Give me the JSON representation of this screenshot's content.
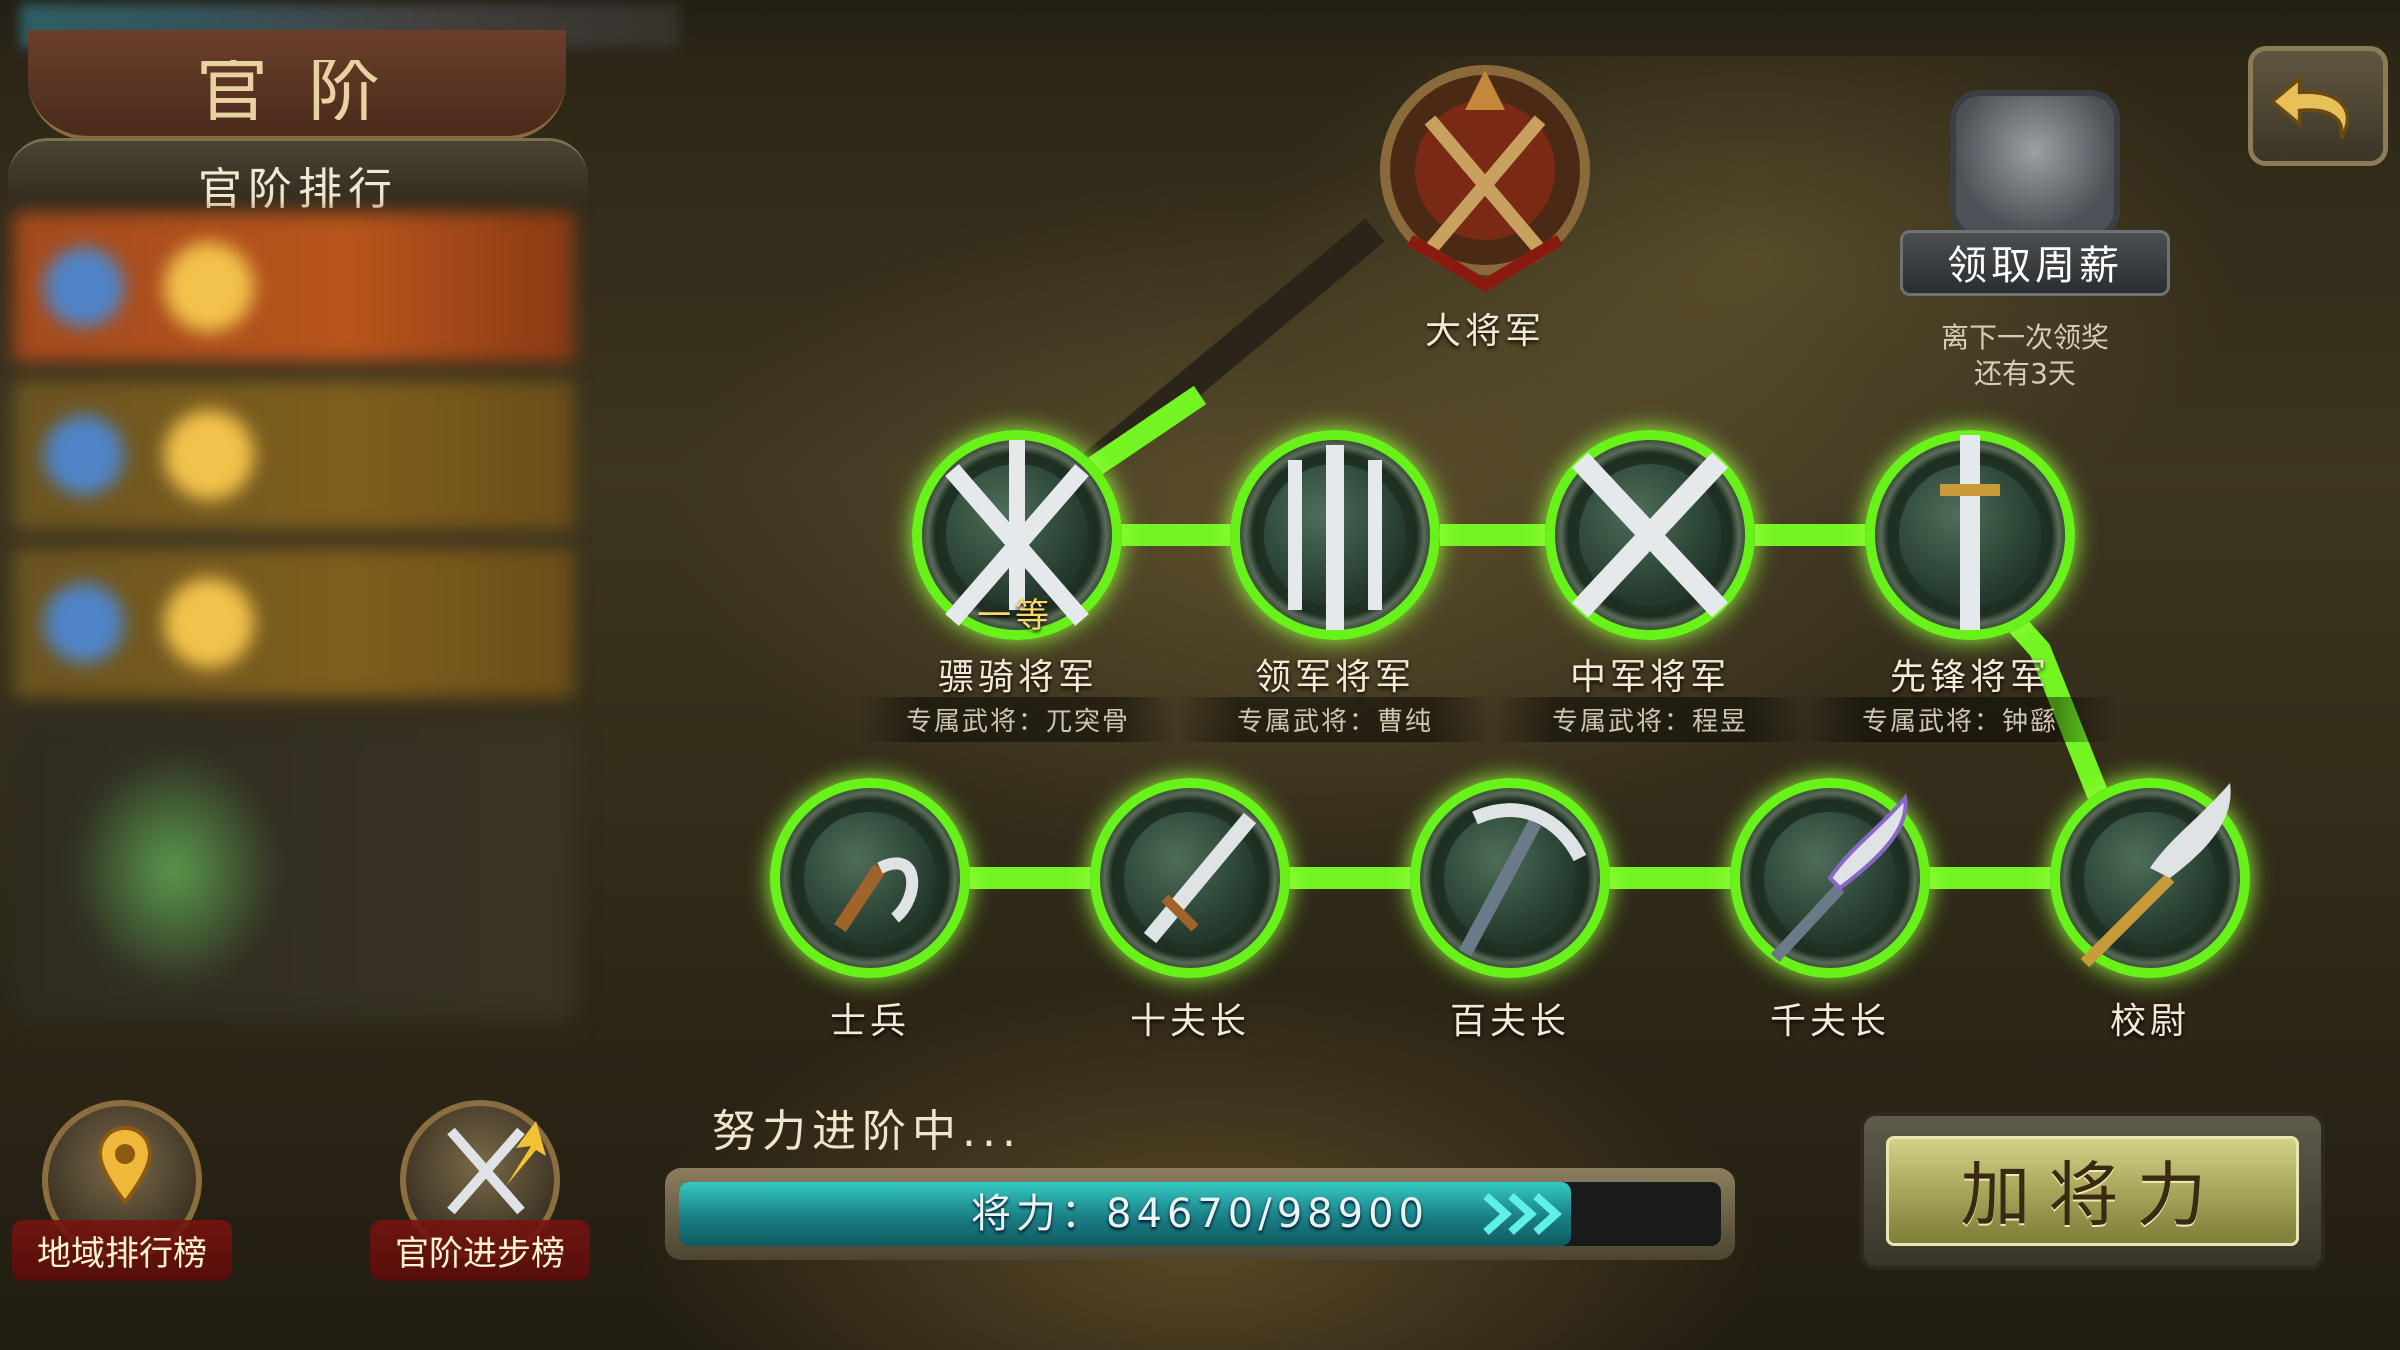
{
  "header": {
    "title_glyphs": "官阶"
  },
  "ranking": {
    "title": "官阶排行"
  },
  "left_buttons": {
    "region_rank_label": "地域排行榜",
    "progress_rank_label": "官阶进步榜"
  },
  "top_rank": {
    "label": "大将军"
  },
  "chest": {
    "label": "领取周薪",
    "note_line1": "离下一次领奖",
    "note_line2": "还有3天"
  },
  "upper_ranks": [
    {
      "label": "骠骑将军",
      "sub": "专属武将：兀突骨",
      "badge": "一等"
    },
    {
      "label": "领军将军",
      "sub": "专属武将：曹纯"
    },
    {
      "label": "中军将军",
      "sub": "专属武将：程昱"
    },
    {
      "label": "先锋将军",
      "sub": "专属武将：钟繇"
    }
  ],
  "lower_ranks": [
    {
      "label": "士兵"
    },
    {
      "label": "十夫长"
    },
    {
      "label": "百夫长"
    },
    {
      "label": "千夫长"
    },
    {
      "label": "校尉"
    }
  ],
  "progress": {
    "caption": "努力进阶中...",
    "text": "将力：84670/98900",
    "current": 84670,
    "max": 98900
  },
  "add_power_button": {
    "label": "加将力"
  },
  "colors": {
    "glow_green": "#69f21a",
    "progress_teal": "#1a7f86",
    "gold_text": "#ffd86a"
  },
  "icons": {
    "back": "undo-arrow-icon",
    "chest": "treasure-chest-icon",
    "region": "map-pin-icon",
    "progress_rank": "crossed-swords-arrow-icon"
  }
}
